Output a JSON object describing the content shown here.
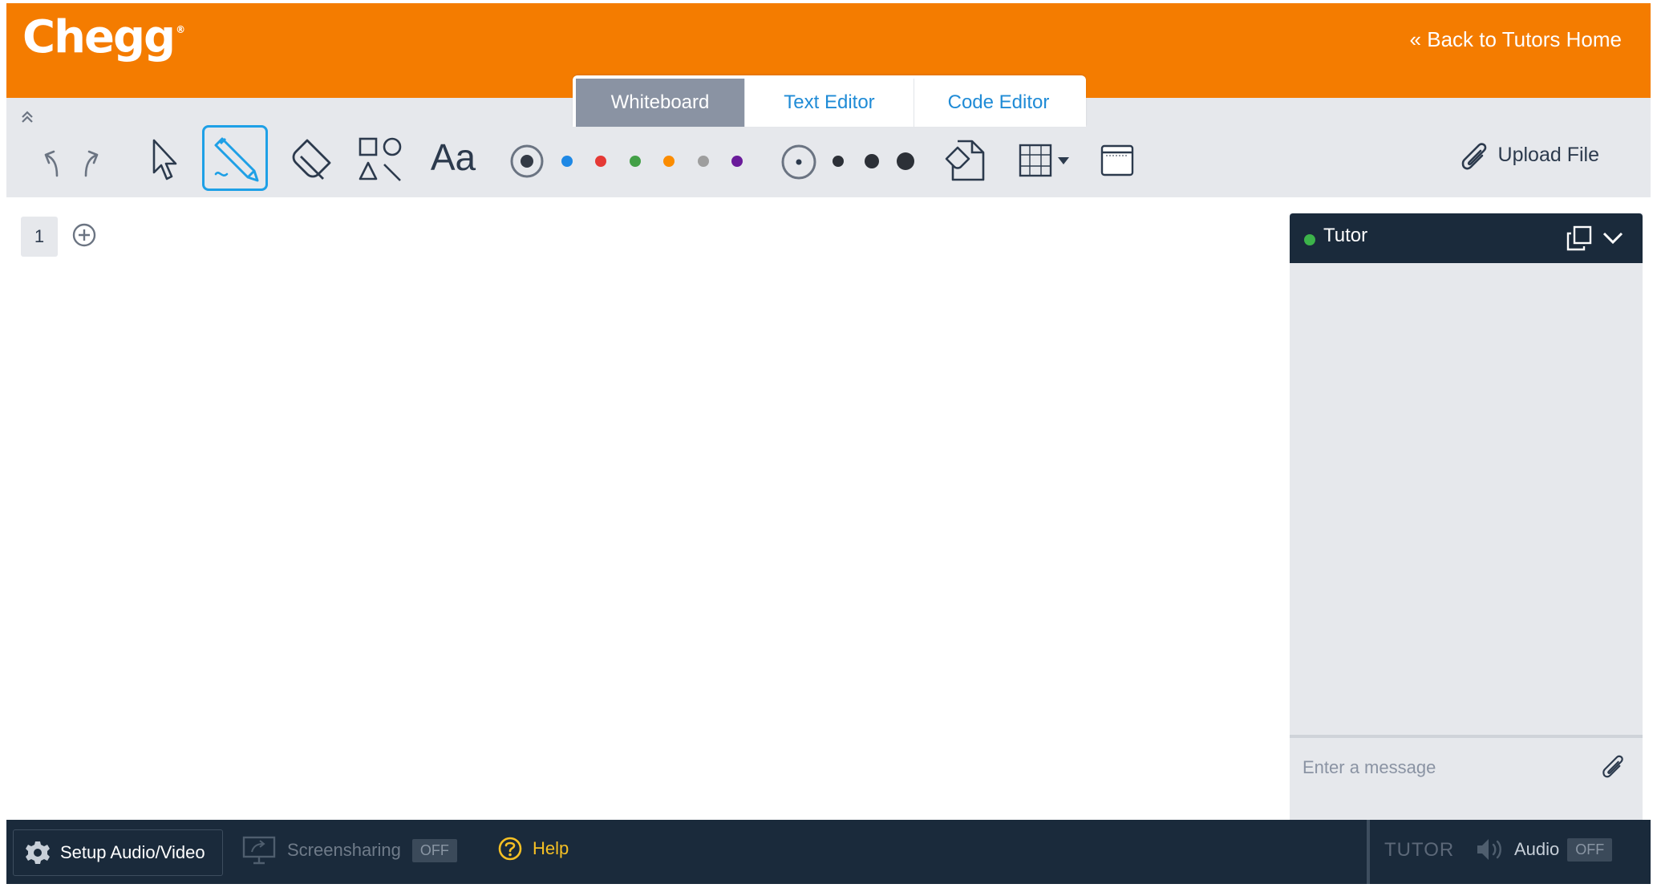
{
  "header": {
    "logo_text": "Chegg",
    "back_link": "« Back to Tutors Home",
    "brand_color": "#f47c00"
  },
  "tabs": [
    {
      "label": "Whiteboard",
      "active": true
    },
    {
      "label": "Text Editor",
      "active": false
    },
    {
      "label": "Code Editor",
      "active": false
    }
  ],
  "toolbar": {
    "collapse_icon": "double-chevron-up-icon",
    "tools": [
      "undo-icon",
      "redo-icon",
      "pointer-icon",
      "pencil-icon",
      "eraser-icon",
      "shapes-icon",
      "text-icon",
      "image-icon",
      "grid-icon",
      "frame-icon"
    ],
    "selected_tool": "pencil-icon",
    "text_tool_label": "Aa",
    "colors": [
      "#333a45",
      "#1e88e5",
      "#e53935",
      "#43a047",
      "#fb8c00",
      "#9e9e9e",
      "#6a1b9a"
    ],
    "selected_color": "#333a45",
    "stroke_sizes": [
      "xs",
      "s",
      "m",
      "l"
    ],
    "selected_size": "xs",
    "upload_label": "Upload File"
  },
  "canvas": {
    "page_number": "1",
    "add_page_icon": "plus-circle-icon"
  },
  "chat": {
    "title": "Tutor",
    "status_color": "#3cb34a",
    "popout_icon": "popout-icon",
    "collapse_icon": "chevron-down-icon",
    "input_placeholder": "Enter a message",
    "attach_icon": "paperclip-icon"
  },
  "bottom_bar": {
    "setup_label": "Setup Audio/Video",
    "screenshare_label": "Screensharing",
    "screenshare_state": "OFF",
    "help_label": "Help",
    "tutor_label": "TUTOR",
    "audio_label": "Audio",
    "audio_state": "OFF"
  }
}
